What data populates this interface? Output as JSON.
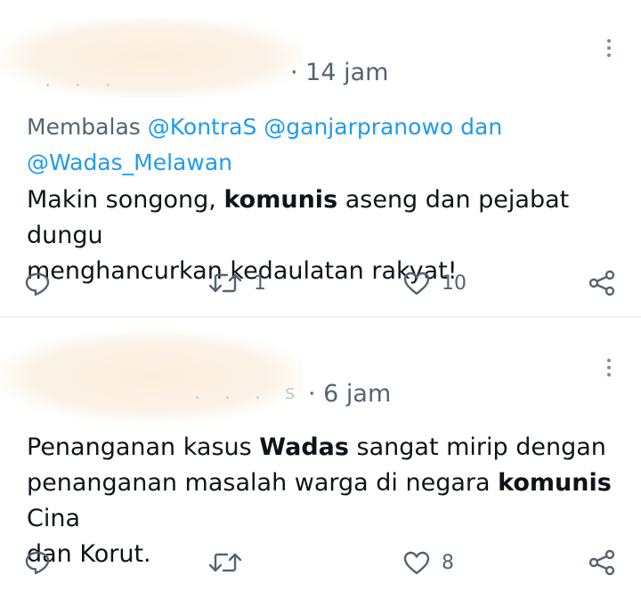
{
  "tweets": [
    {
      "time": "· 14 jam",
      "reply_prefix": "Membalas",
      "mentions": [
        "@KontraS",
        "@ganjarpranowo",
        "@Wadas_Melawan"
      ],
      "mention_joiner": "dan",
      "text": {
        "line1_pre": "Makin songong, ",
        "line1_bold": "komunis",
        "line1_post": " aseng dan pejabat dungu",
        "line2": "menghancurkan kedaulatan rakyat!"
      },
      "actions": {
        "reply_count": "",
        "retweet_count": "1",
        "like_count": "10"
      }
    },
    {
      "time": "· 6 jam",
      "text": {
        "line1_pre": "Penanganan kasus ",
        "line1_bold": "Wadas",
        "line1_post": " sangat mirip dengan",
        "line2_pre": "penanganan masalah warga di negara ",
        "line2_bold": "komunis",
        "line2_post": " Cina",
        "line3": "dan Korut."
      },
      "actions": {
        "reply_count": "",
        "retweet_count": "",
        "like_count": "8"
      }
    }
  ],
  "icons": {
    "reply": "reply-icon",
    "retweet": "retweet-icon",
    "like": "heart-icon",
    "share": "share-icon",
    "more": "more-vertical-icon"
  },
  "colors": {
    "text": "#0f1419",
    "muted": "#536471",
    "mention": "#1d9bf0",
    "divider": "#eff1f3"
  }
}
